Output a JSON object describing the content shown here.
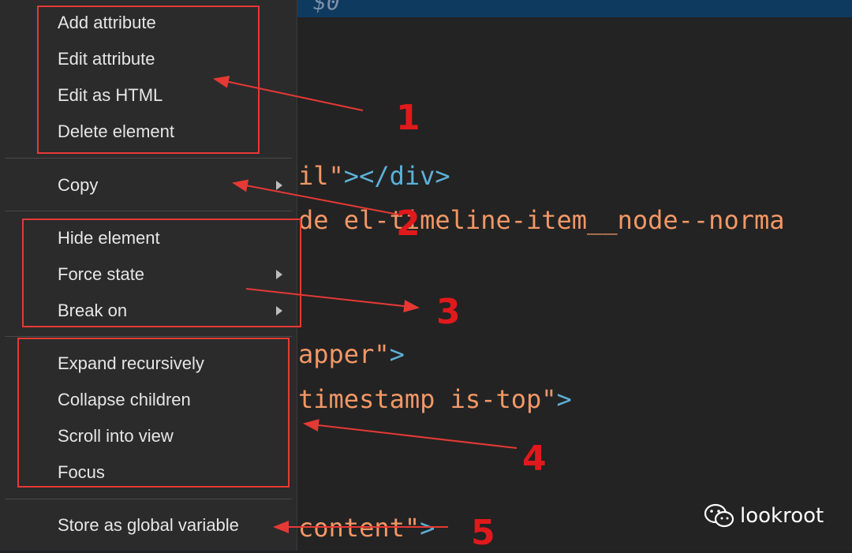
{
  "header_code": "$0",
  "code_lines": [
    {
      "parts": [
        {
          "text": "il\"",
          "cls": "c-str"
        },
        {
          "text": "></div>",
          "cls": "c-tag"
        }
      ]
    },
    {
      "parts": [
        {
          "text": "de el-timeline-item__node--norma",
          "cls": "c-str"
        }
      ]
    },
    {
      "parts": [
        {
          "text": "apper\"",
          "cls": "c-str"
        },
        {
          "text": ">",
          "cls": "c-tag"
        }
      ]
    },
    {
      "parts": [
        {
          "text": "timestamp is-top\"",
          "cls": "c-str"
        },
        {
          "text": ">",
          "cls": "c-tag"
        }
      ]
    },
    {
      "parts": [
        {
          "text": "content\"",
          "cls": "c-str"
        },
        {
          "text": ">",
          "cls": "c-tag"
        }
      ]
    }
  ],
  "menu": {
    "add_attribute": "Add attribute",
    "edit_attribute": "Edit attribute",
    "edit_as_html": "Edit as HTML",
    "delete_element": "Delete element",
    "copy": "Copy",
    "hide_element": "Hide element",
    "force_state": "Force state",
    "break_on": "Break on",
    "expand_recursively": "Expand recursively",
    "collapse_children": "Collapse children",
    "scroll_into_view": "Scroll into view",
    "focus": "Focus",
    "store_as_global": "Store as global variable"
  },
  "annotations": {
    "n1": "1",
    "n2": "2",
    "n3": "3",
    "n4": "4",
    "n5": "5",
    "color": "#e53935"
  },
  "watermark": {
    "icon": "wechat-icon",
    "brand": "lookroot"
  }
}
